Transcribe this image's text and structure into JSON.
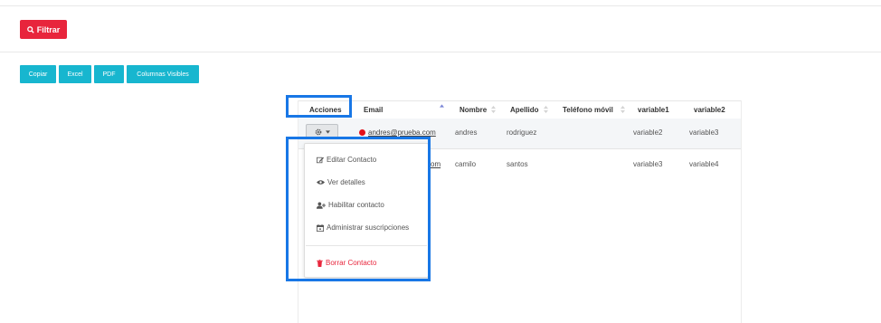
{
  "toolbar": {
    "filter_label": "Filtrar"
  },
  "export_buttons": [
    "Copiar",
    "Excel",
    "PDF",
    "Columnas Visibles"
  ],
  "table": {
    "columns": [
      "Acciones",
      "Email",
      "Nombre",
      "Apellido",
      "Teléfono móvil",
      "variable1",
      "variable2"
    ],
    "rows": [
      {
        "email": "andres@prueba.com",
        "nombre": "andres",
        "apellido": "rodriguez",
        "telefono": "",
        "variable1": "variable2",
        "variable2": "variable3"
      },
      {
        "email": "...prueba.com",
        "email_visible": "om",
        "nombre": "camilo",
        "apellido": "santos",
        "telefono": "",
        "variable1": "variable3",
        "variable2": "variable4"
      }
    ]
  },
  "actions_menu": {
    "items": [
      "Editar Contacto",
      "Ver detalles",
      "Habilitar contacto",
      "Administrar suscripciones"
    ],
    "danger_item": "Borrar Contacto"
  },
  "colors": {
    "primary_red": "#e8253c",
    "export_cyan": "#17b6cf",
    "highlight_blue": "#1877e6",
    "status_dot": "#e3101b"
  },
  "icons": [
    "search-icon",
    "gear-icon",
    "caret-down-icon",
    "sort-icon",
    "edit-icon",
    "eye-icon",
    "user-plus-icon",
    "calendar-icon",
    "trash-icon"
  ]
}
